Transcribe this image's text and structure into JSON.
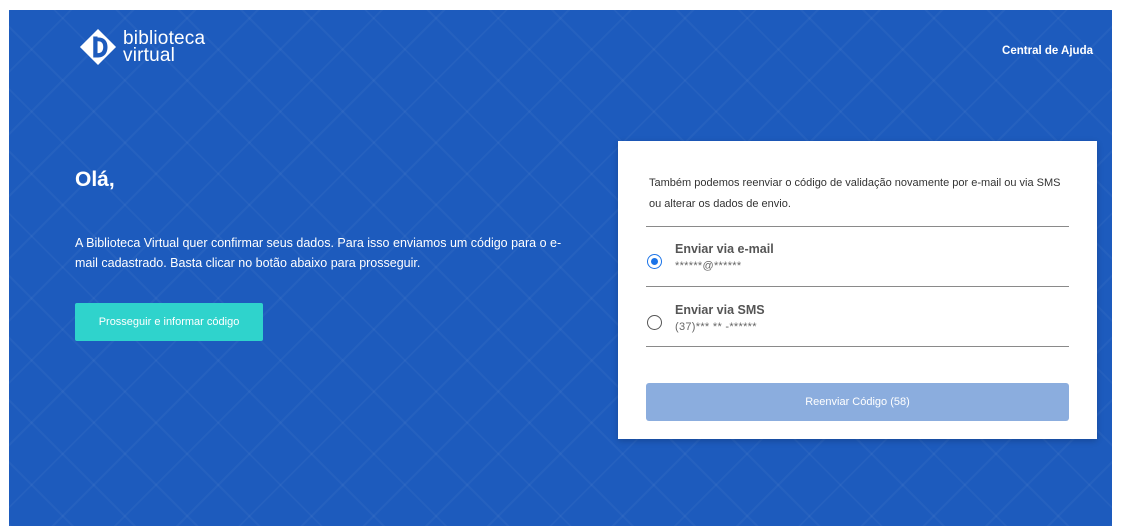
{
  "header": {
    "logo": {
      "line1": "biblioteca",
      "line2": "virtual",
      "icon": "biblioteca-virtual-logo-icon"
    },
    "help_link": "Central de Ajuda"
  },
  "left": {
    "greeting": "Olá,",
    "intro": "A Biblioteca Virtual quer confirmar seus dados. Para isso enviamos um código para o e-mail cadastrado. Basta clicar no botão abaixo para prosseguir.",
    "proceed_button": "Prosseguir e informar código"
  },
  "card": {
    "description": "Também podemos reenviar o código de validação novamente por e-mail ou via SMS ou alterar os dados de envio.",
    "options": [
      {
        "title": "Enviar via e-mail",
        "detail": "******@******",
        "selected": true
      },
      {
        "title": "Enviar via SMS",
        "detail": "(37)*** ** -******",
        "selected": false
      }
    ],
    "resend_button": "Reenviar Código (58)"
  },
  "colors": {
    "background": "#1d5bbd",
    "primary_button": "#2fd3cc",
    "resend_button_disabled": "#8badde",
    "radio_selected": "#1a73e8"
  }
}
